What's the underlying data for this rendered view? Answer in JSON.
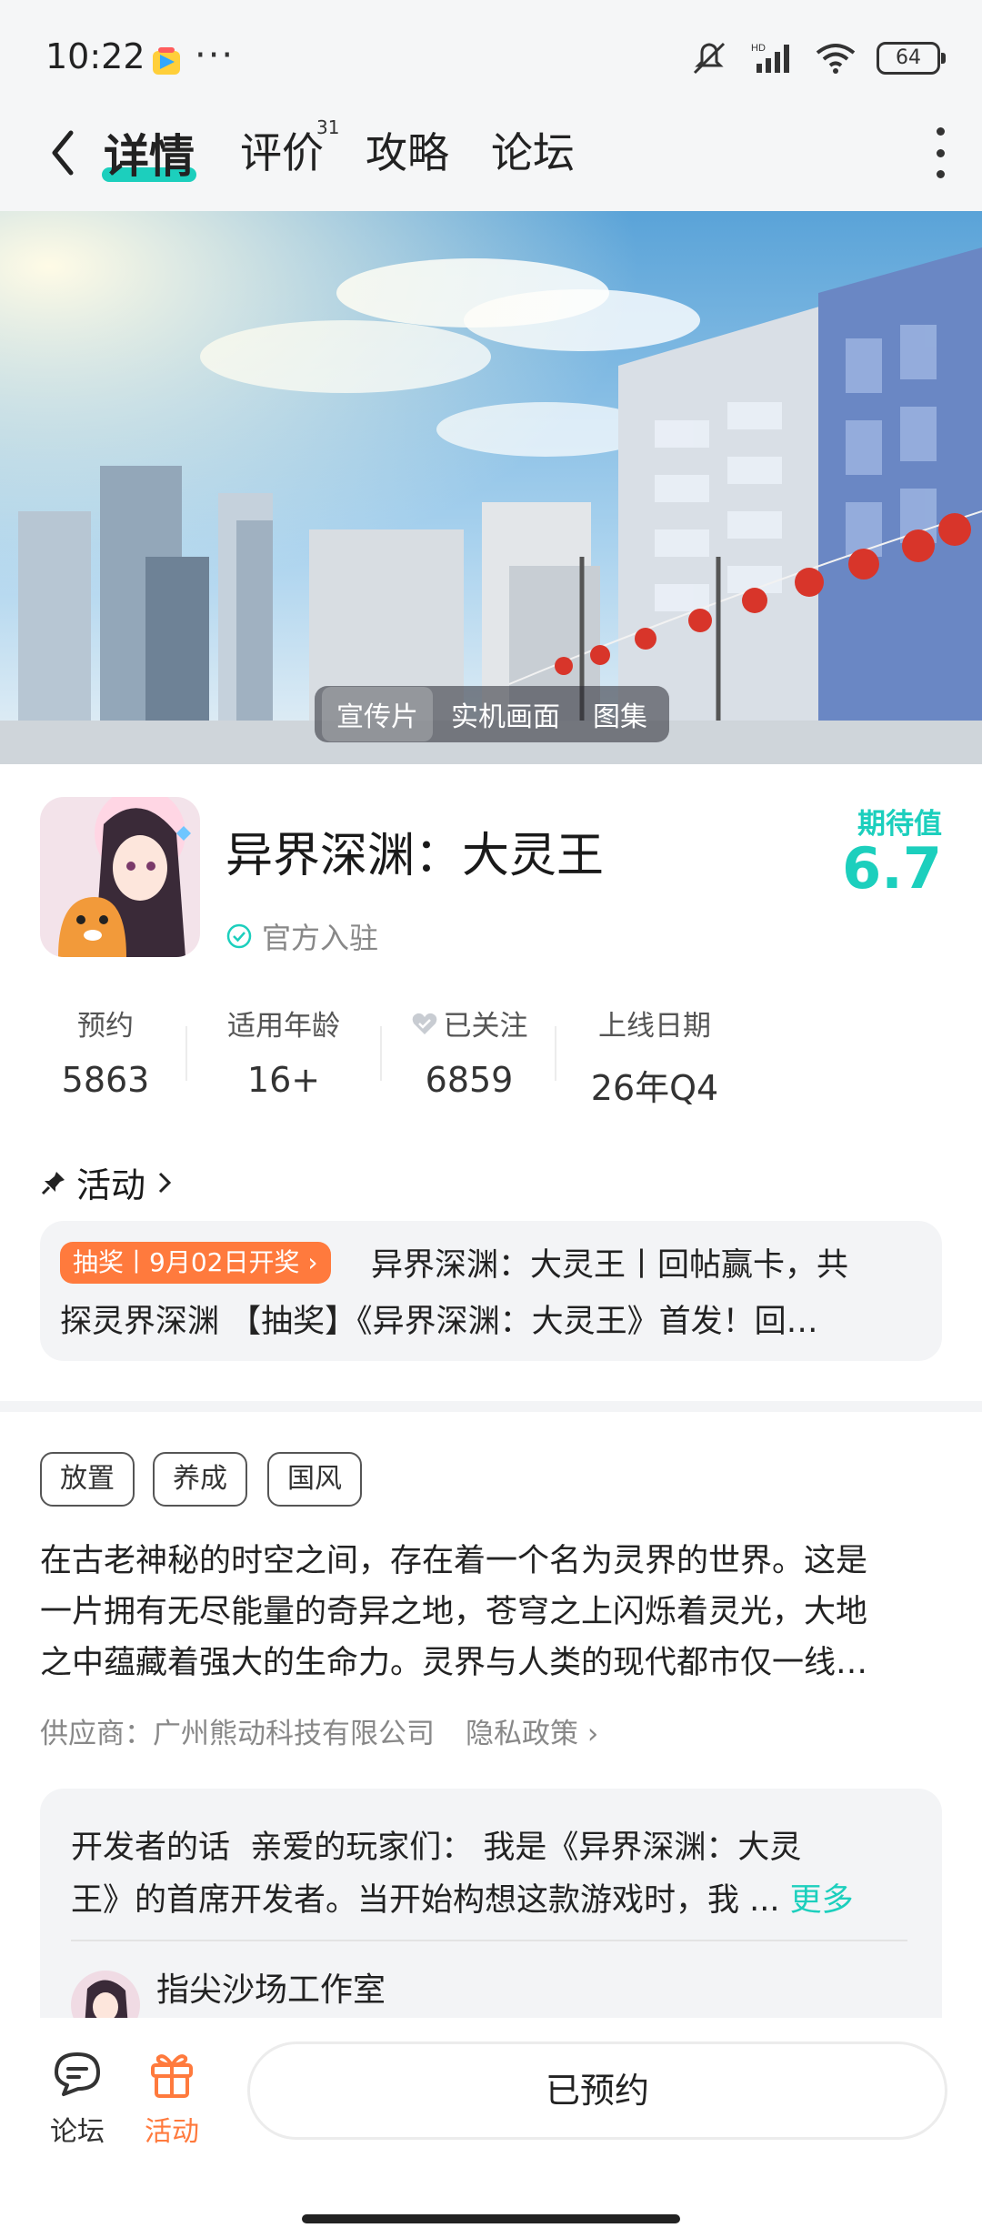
{
  "status_bar": {
    "time": "10:22",
    "dots": "···",
    "battery": "64"
  },
  "nav": {
    "tabs": [
      {
        "label": "详情",
        "active": true
      },
      {
        "label": "评价",
        "badge": "31"
      },
      {
        "label": "攻略"
      },
      {
        "label": "论坛"
      }
    ]
  },
  "media_tabs": [
    "宣传片",
    "实机画面",
    "图集"
  ],
  "game": {
    "title": "异界深渊：大灵王",
    "official": "官方入驻",
    "expect_label": "期待值",
    "expect_value": "6.7"
  },
  "stats": [
    {
      "label": "预约",
      "value": "5863"
    },
    {
      "label": "适用年龄",
      "value": "16+"
    },
    {
      "label": "已关注",
      "value": "6859"
    },
    {
      "label": "上线日期",
      "value": "26年Q4"
    }
  ],
  "activity": {
    "heading": "活动",
    "badge": "抽奖丨9月02日开奖",
    "line1": "异界深渊：大灵王丨回帖赢卡，共",
    "line2": "探灵界深渊 【抽奖】《异界深渊：大灵王》首发！回…"
  },
  "tags": [
    "放置",
    "养成",
    "国风"
  ],
  "description": {
    "line1": "在古老神秘的时空之间，存在着一个名为灵界的世界。这是",
    "line2": "一片拥有无尽能量的奇异之地，苍穹之上闪烁着灵光，大地",
    "line3": "之中蕴藏着强大的生命力。灵界与人类的现代都市仅一线…"
  },
  "vendor": {
    "label": "供应商：广州熊动科技有限公司",
    "privacy": "隐私政策"
  },
  "developer": {
    "heading": "开发者的话",
    "line1": "亲爱的玩家们：  我是《异界深渊：大灵",
    "line2": "王》的首席开发者。当开始构想这款游戏时，我 ...",
    "more": "更多",
    "name": "指尖沙场工作室"
  },
  "bottom_bar": {
    "forum": "论坛",
    "activity": "活动",
    "reserve": "已预约"
  },
  "colors": {
    "accent": "#1ccfbd",
    "orange": "#ff7a3d",
    "bg": "#f5f6f7"
  }
}
